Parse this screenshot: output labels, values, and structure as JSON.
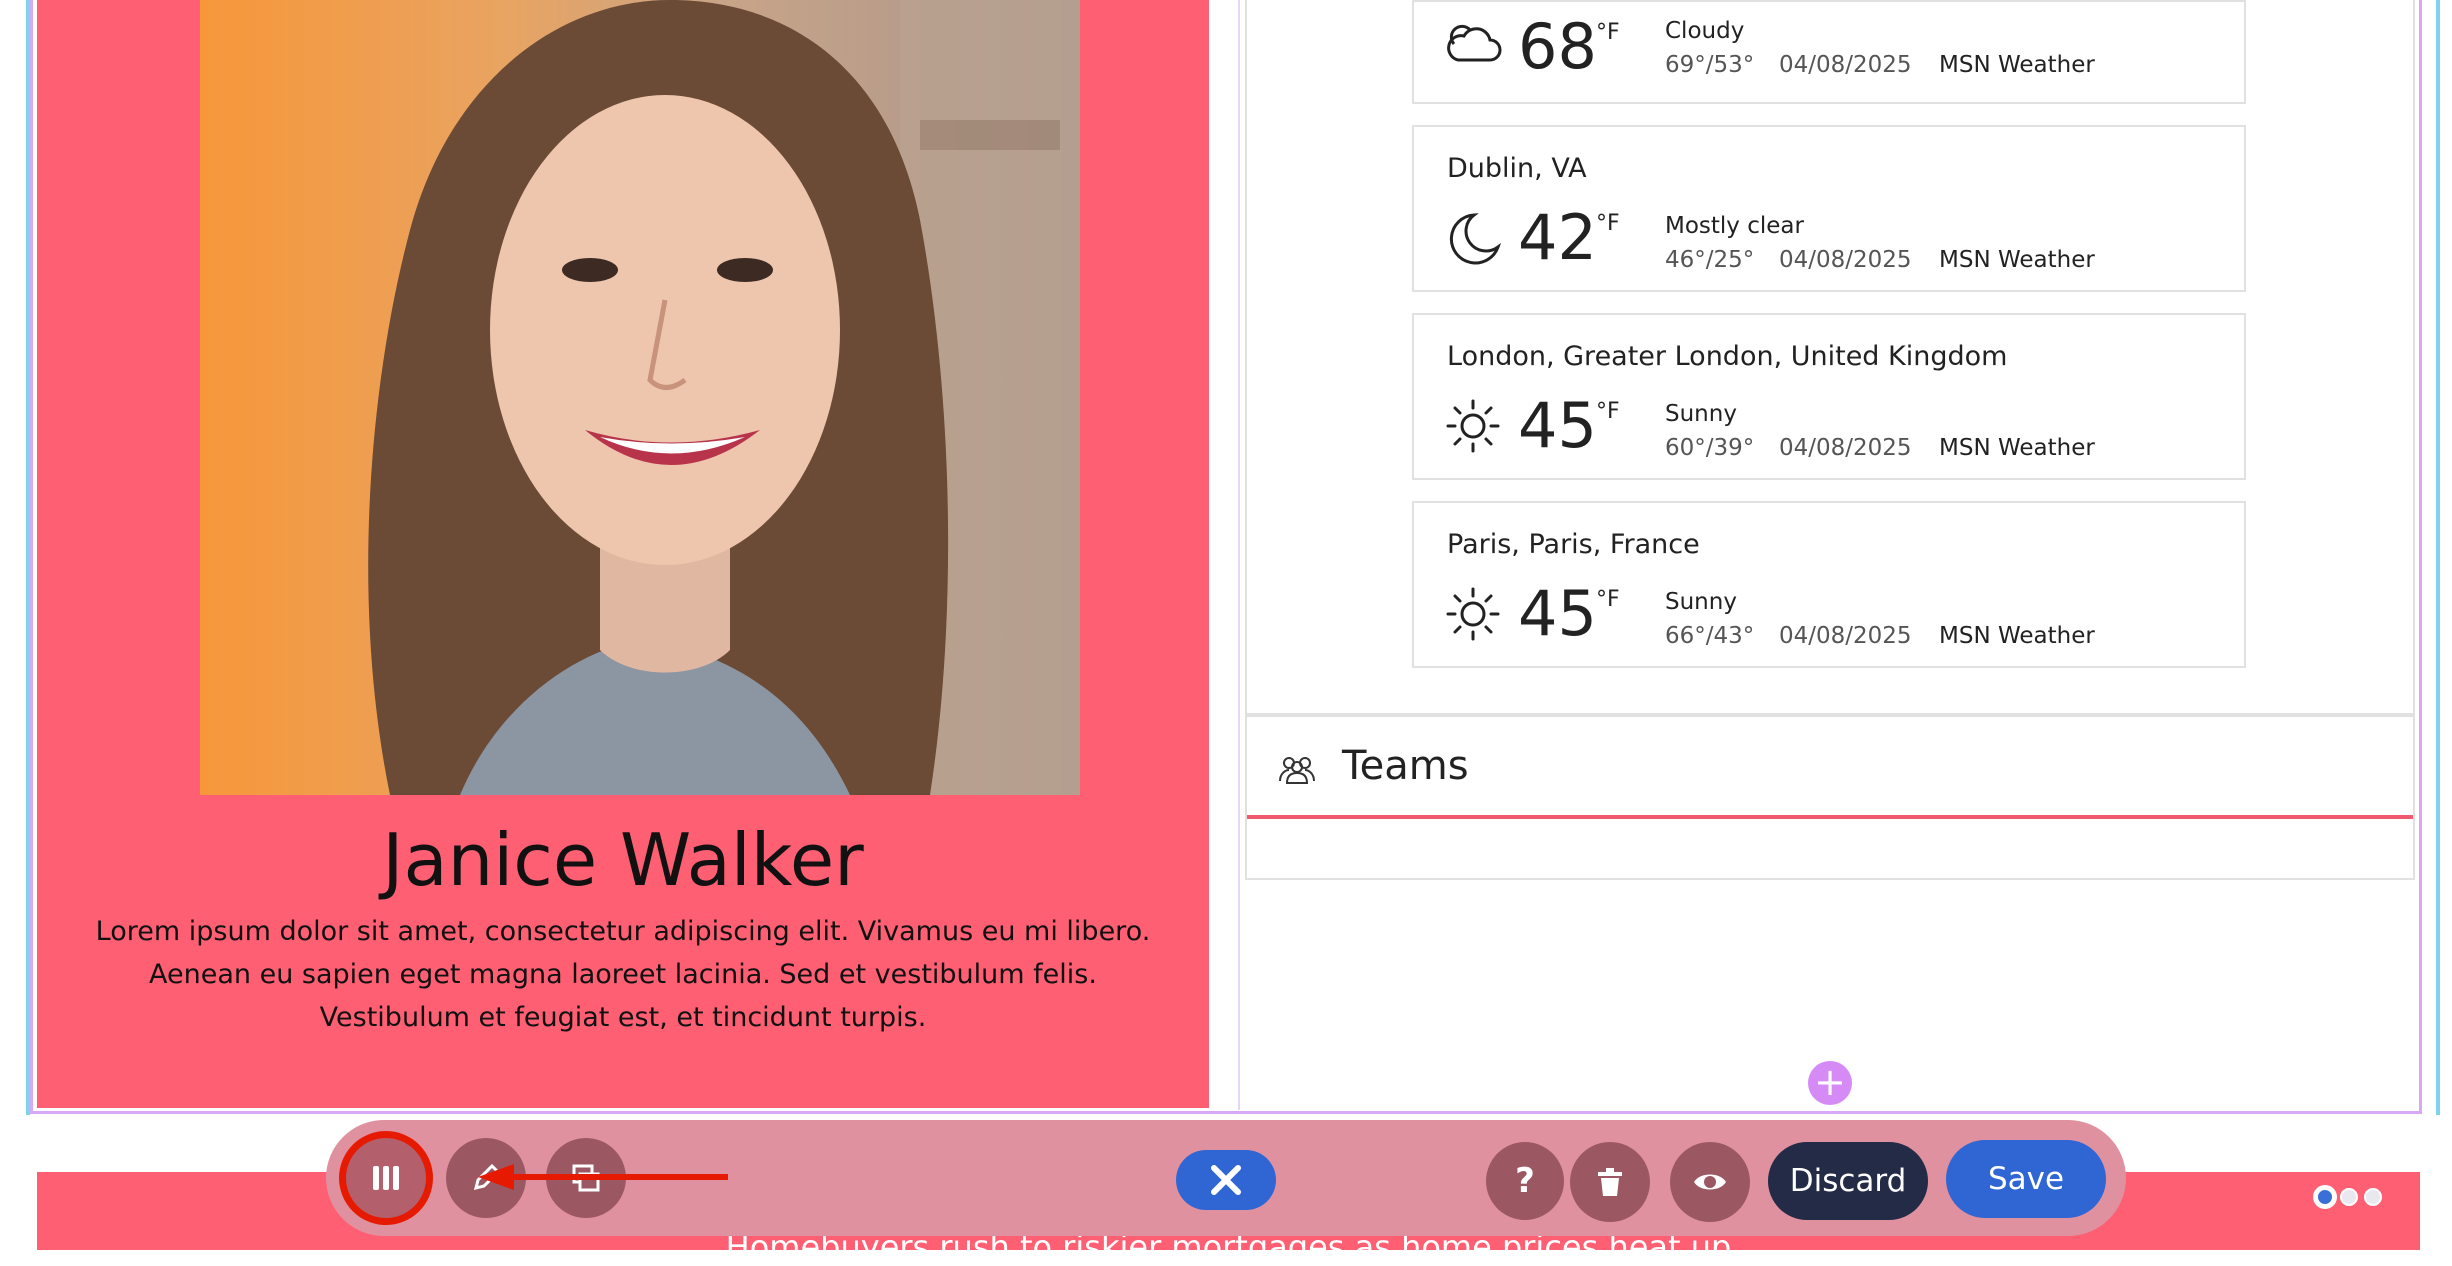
{
  "profile": {
    "name": "Janice Walker",
    "bio": "Lorem ipsum dolor sit amet, consectetur adipiscing elit. Vivamus eu mi libero. Aenean eu sapien eget magna laoreet lacinia. Sed et vestibulum felis. Vestibulum et feugiat est, et tincidunt turpis."
  },
  "weather": {
    "cards": [
      {
        "location": "",
        "icon": "cloud-icon",
        "temp": "68",
        "unit": "°F",
        "condition": "Cloudy",
        "range": "69°/53°",
        "date": "04/08/2025",
        "source": "MSN Weather"
      },
      {
        "location": "Dublin, VA",
        "icon": "moon-icon",
        "temp": "42",
        "unit": "°F",
        "condition": "Mostly clear",
        "range": "46°/25°",
        "date": "04/08/2025",
        "source": "MSN Weather"
      },
      {
        "location": "London, Greater London, United Kingdom",
        "icon": "sun-icon",
        "temp": "45",
        "unit": "°F",
        "condition": "Sunny",
        "range": "60°/39°",
        "date": "04/08/2025",
        "source": "MSN Weather"
      },
      {
        "location": "Paris, Paris, France",
        "icon": "sun-icon",
        "temp": "45",
        "unit": "°F",
        "condition": "Sunny",
        "range": "66°/43°",
        "date": "04/08/2025",
        "source": "MSN Weather"
      }
    ]
  },
  "teams": {
    "title": "Teams"
  },
  "add_section": {
    "label": "+"
  },
  "banner": {
    "headline": "Homebuyers rush to riskier mortgages as home prices heat up"
  },
  "toolbar": {
    "discard_label": "Discard",
    "save_label": "Save",
    "help_label": "?"
  },
  "colors": {
    "accent_red": "#ff5f73",
    "toolbar_bg": "#e0919f",
    "primary_blue": "#2f66d3",
    "discard_dark": "#232b47",
    "highlight_ring": "#e51a00"
  }
}
